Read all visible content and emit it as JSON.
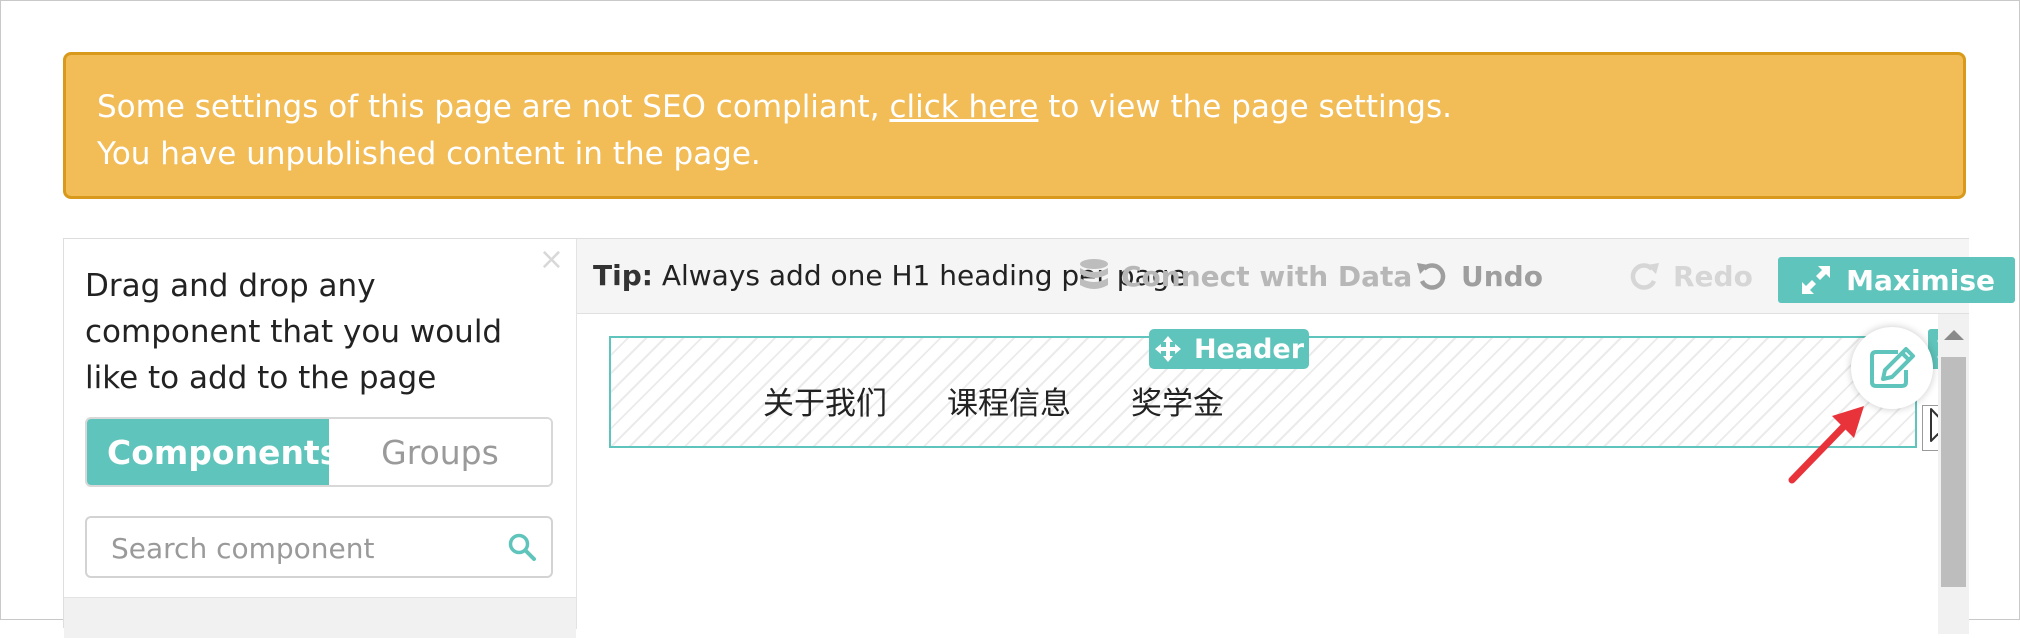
{
  "banner": {
    "line1_before": "Some settings of this page are not SEO compliant,",
    "link": "click here",
    "line1_after": "to view the page settings.",
    "line2": "You have unpublished content in the page."
  },
  "left_panel": {
    "close_label": "×",
    "description": "Drag and drop any component that you would like to add to the page",
    "tabs": [
      {
        "label": "Components",
        "active": true
      },
      {
        "label": "Groups",
        "active": false
      }
    ],
    "search": {
      "placeholder": "Search component",
      "value": ""
    }
  },
  "toolbar": {
    "tip_label": "Tip:",
    "tip_text": "Always add one H1 heading per page",
    "connect_label": "Connect with Data",
    "undo_label": "Undo",
    "redo_label": "Redo",
    "maximise_label": "Maximise"
  },
  "canvas": {
    "header_tag": "Header",
    "nav_items": [
      "关于我们",
      "课程信息",
      "奖学金"
    ]
  },
  "colors": {
    "accent": "#5fc4bb",
    "banner_bg": "#f2bc57",
    "banner_border": "#d99a1b",
    "arrow": "#e8333a"
  },
  "icons": [
    "search-icon",
    "database-icon",
    "undo-icon",
    "redo-icon",
    "expand-icon",
    "move-icon",
    "close-icon",
    "edit-icon",
    "cursor-icon",
    "arrow-annotation"
  ]
}
